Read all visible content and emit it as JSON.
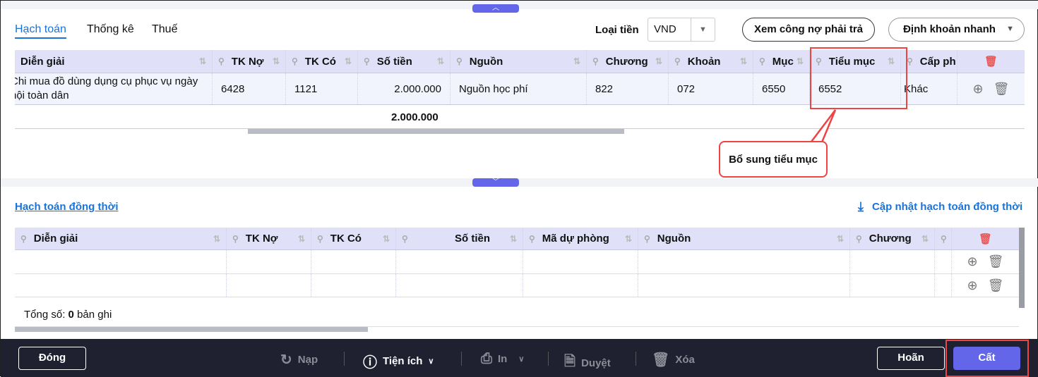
{
  "tabs": [
    {
      "label": "Hạch toán",
      "active": true
    },
    {
      "label": "Thống kê"
    },
    {
      "label": "Thuế"
    }
  ],
  "currency": {
    "label": "Loại tiền",
    "value": "VND"
  },
  "buttons": {
    "view_debt": "Xem công nợ phải trả",
    "quick_entry": "Định khoản nhanh"
  },
  "main_table": {
    "columns": [
      "Diễn giải",
      "TK Nợ",
      "TK Có",
      "Số tiền",
      "Nguồn",
      "Chương",
      "Khoản",
      "Mục",
      "Tiểu mục",
      "Cấp ph"
    ],
    "rows": [
      {
        "dien_giai_1": "Chi mua đồ dùng dụng cụ phục vụ ngày",
        "dien_giai_2": "hội toàn dân",
        "tk_no": "6428",
        "tk_co": "1121",
        "so_tien": "2.000.000",
        "nguon": "Nguồn học phí",
        "chuong": "822",
        "khoan": "072",
        "muc": "6550",
        "tieu_muc": "6552",
        "cap_phat": "Khác"
      }
    ],
    "total": "2.000.000"
  },
  "callout": "Bổ sung tiểu mục",
  "concurrent": {
    "title": "Hạch toán đồng thời",
    "update_link": "Cập nhật hạch toán đồng thời",
    "columns": [
      "Diễn giải",
      "TK Nợ",
      "TK Có",
      "Số tiền",
      "Mã dự phòng",
      "Nguồn",
      "Chương"
    ],
    "count_prefix": "Tổng số:",
    "count": "0",
    "count_suffix": "bản ghi"
  },
  "footer": {
    "close": "Đóng",
    "reload": "Nạp",
    "utilities": "Tiện ích",
    "print": "In",
    "approve": "Duyệt",
    "delete": "Xóa",
    "cancel": "Hoãn",
    "save": "Cất"
  },
  "colors": {
    "accent": "#6366e8",
    "link": "#1a73d9",
    "highlight": "#ef4444",
    "footer": "#1f2130"
  }
}
